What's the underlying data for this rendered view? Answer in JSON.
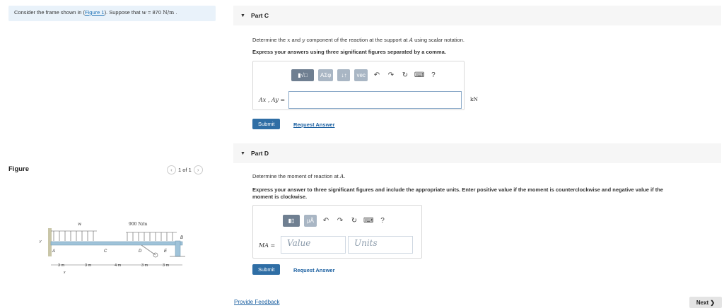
{
  "problem": {
    "text_before": "Consider the frame shown in (",
    "figure_link": "Figure 1",
    "text_after": "). Suppose that ",
    "w_symbol": "w",
    "equals": " = 870 ",
    "w_unit": "N/m",
    "period": " ."
  },
  "figure_panel": {
    "title": "Figure",
    "pager_text": "1 of 1",
    "prev_icon": "chevron-left-icon",
    "next_icon": "chevron-right-icon"
  },
  "diagram": {
    "load_w": "w",
    "load_900": "900 N/m",
    "labels": [
      "A",
      "C",
      "D",
      "E",
      "B",
      "y",
      "x"
    ],
    "dims": [
      "3 m",
      "3 m",
      "4 m",
      "3 m",
      "3 m"
    ]
  },
  "part_c": {
    "title": "Part C",
    "instruction_1": "Determine the ",
    "x": "x",
    "and": " and ",
    "y": "y",
    "instruction_2": " component of the reaction at the support at ",
    "A": "A",
    "instruction_3": " using scalar notation.",
    "bold_instruction": "Express your answers using three significant figures separated by a comma.",
    "toolbar": [
      "ΑΣφ",
      "↓↑",
      "vec",
      "?"
    ],
    "field_label": "Ax , Ay =",
    "field_value": "",
    "unit": "kN",
    "submit": "Submit",
    "request_answer": "Request Answer"
  },
  "part_d": {
    "title": "Part D",
    "instruction_1": "Determine the moment of reaction at ",
    "A": "A",
    "instruction_2": ".",
    "bold_instruction_line1": "Express your answer to three significant figures and include the appropriate units. Enter positive value if the moment is counterclockwise and negative value if the",
    "bold_instruction_line2": "moment is clockwise.",
    "toolbar": [
      "μÅ",
      "?"
    ],
    "field_label": "MA =",
    "value_placeholder": "Value",
    "units_placeholder": "Units",
    "submit": "Submit",
    "request_answer": "Request Answer"
  },
  "footer": {
    "feedback": "Provide Feedback",
    "next": "Next ❯"
  },
  "colors": {
    "accent": "#2f6ea5",
    "problem_bg": "#e9f2fa",
    "toolbar_btn": "#a9b6c4"
  }
}
